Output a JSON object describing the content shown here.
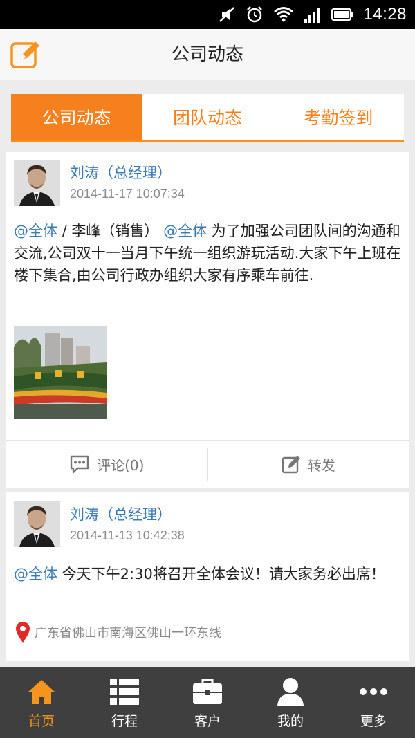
{
  "status_bar": {
    "time": "14:28",
    "icons": [
      "mute-icon",
      "alarm-icon",
      "wifi-icon",
      "signal-icon",
      "battery-icon"
    ]
  },
  "header": {
    "title": "公司动态",
    "left_icon": "edit-icon"
  },
  "tabs": [
    {
      "label": "公司动态",
      "active": true
    },
    {
      "label": "团队动态",
      "active": false
    },
    {
      "label": "考勤签到",
      "active": false
    }
  ],
  "posts": [
    {
      "author": "刘涛（总经理）",
      "time": "2014-11-17 10:07:34",
      "mention_all": "@全体",
      "sep": " / 李峰（销售）",
      "mention_all2": "@全体",
      "text": " 为了加强公司团队间的沟通和交流,公司双十一当月下午统一组织游玩活动.大家下午上班在楼下集合,由公司行政办组织大家有序乘车前往.",
      "has_photo": true,
      "comment_label": "评论(0)",
      "forward_label": "转发"
    },
    {
      "author": "刘涛（总经理）",
      "time": "2014-11-13 10:42:38",
      "mention_all": "@全体",
      "text": " 今天下午2:30将召开全体会议！请大家务必出席！",
      "location": "广东省佛山市南海区佛山一环东线"
    }
  ],
  "bottom_nav": [
    {
      "label": "首页",
      "icon": "home-icon",
      "active": true
    },
    {
      "label": "行程",
      "icon": "list-icon",
      "active": false
    },
    {
      "label": "客户",
      "icon": "briefcase-icon",
      "active": false
    },
    {
      "label": "我的",
      "icon": "person-icon",
      "active": false
    },
    {
      "label": "更多",
      "icon": "more-icon",
      "active": false
    }
  ],
  "colors": {
    "accent": "#f7801e",
    "link": "#3a78b8",
    "nav_bg": "#3f3f3f"
  }
}
